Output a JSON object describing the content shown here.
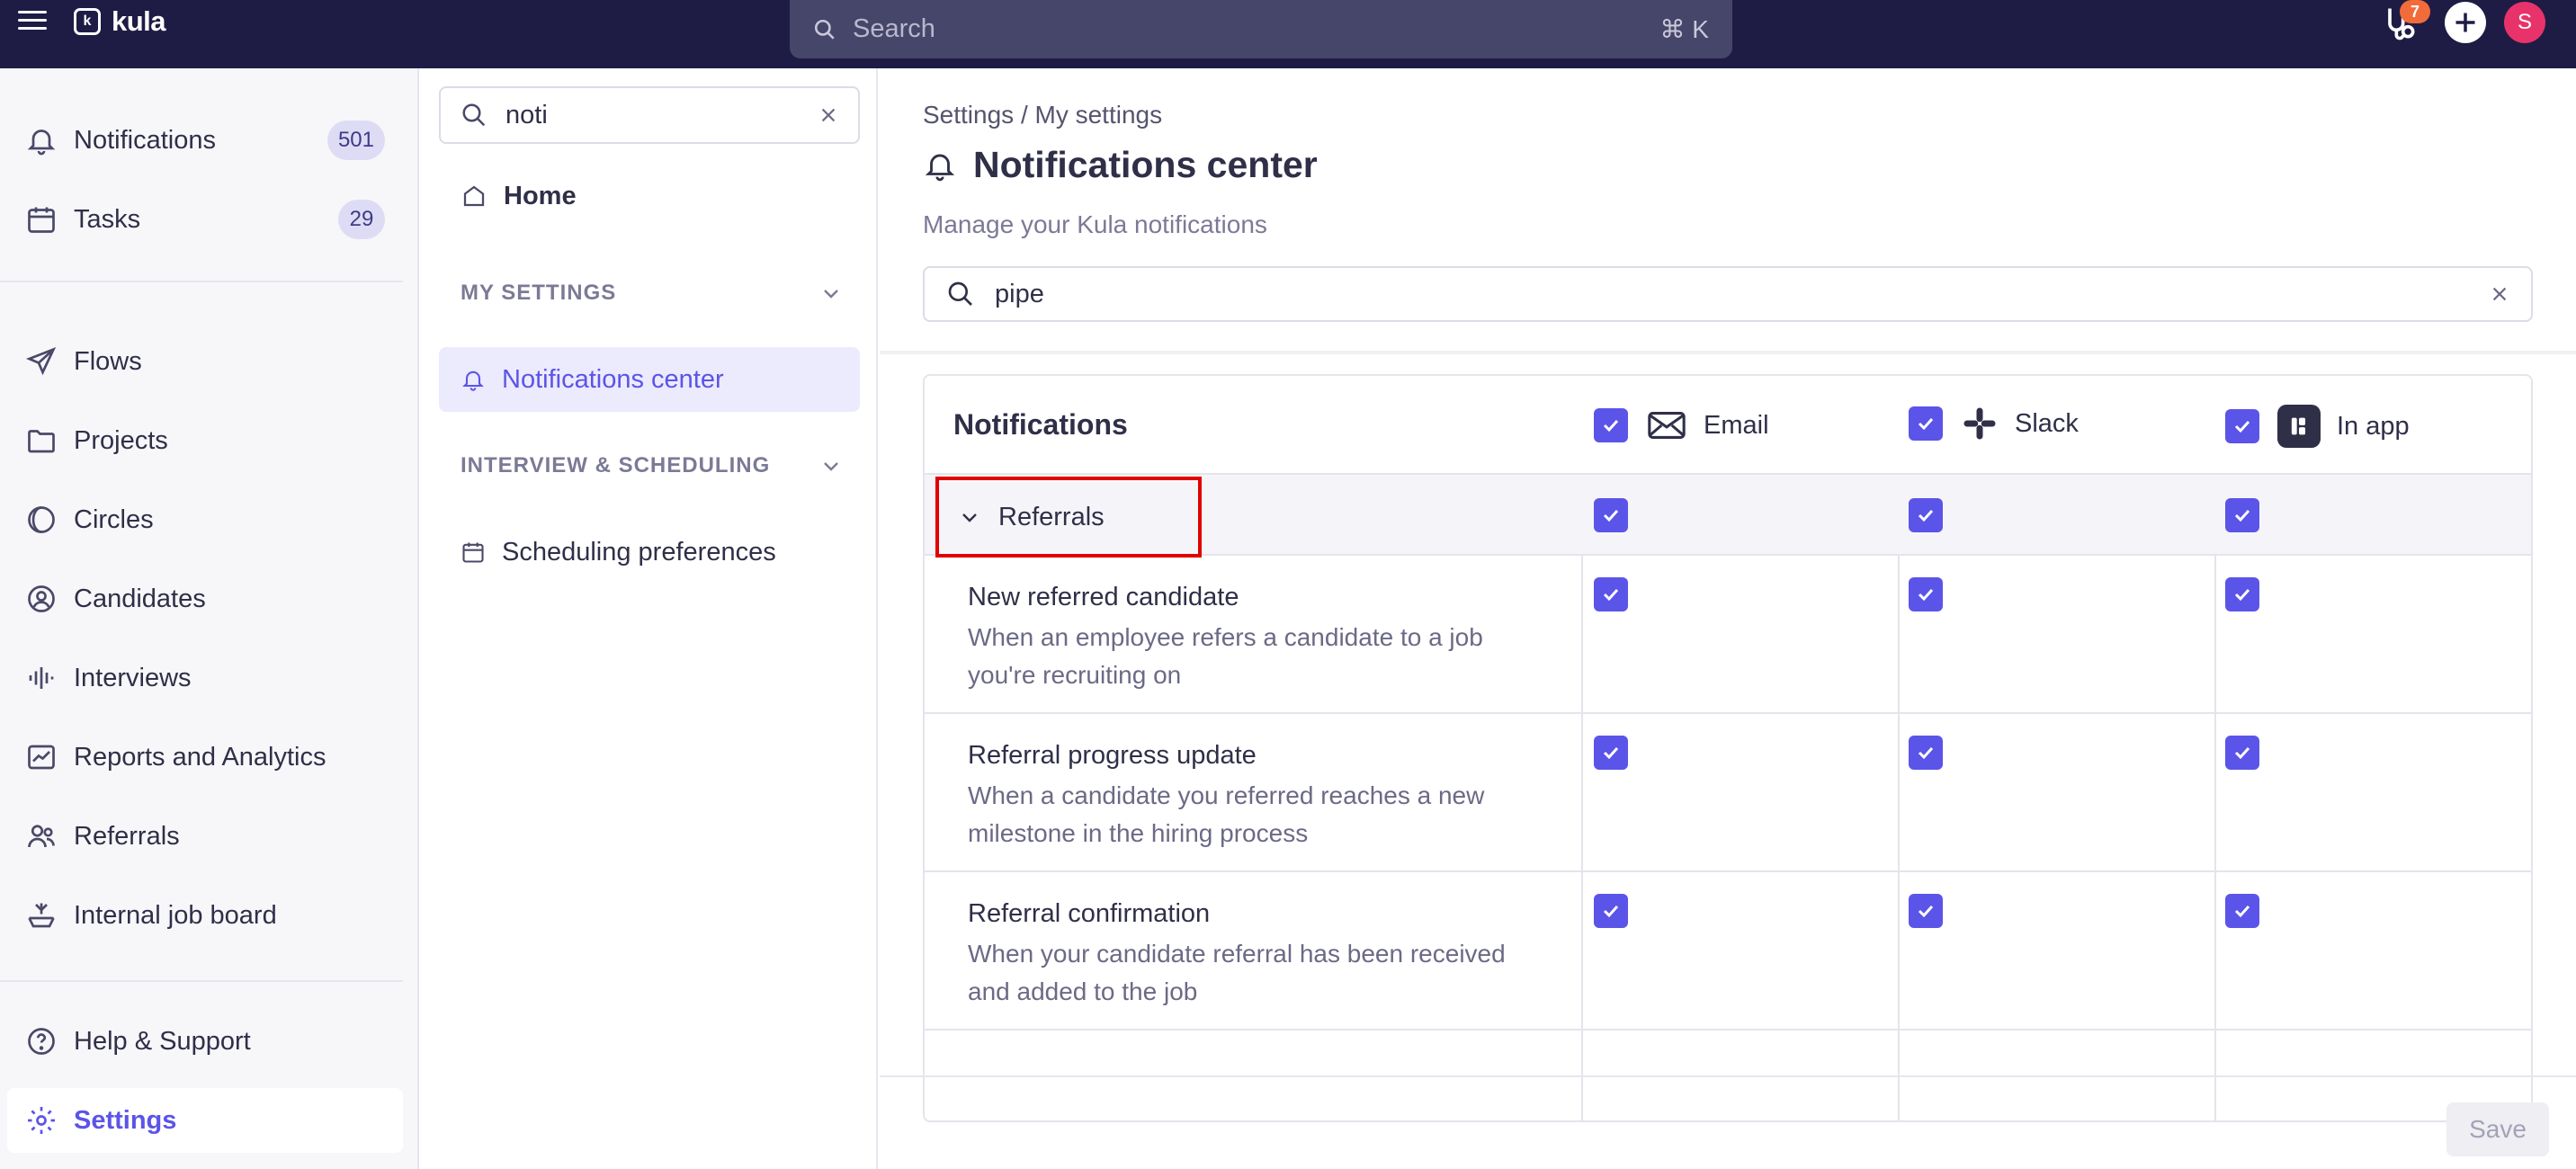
{
  "topbar": {
    "brand": "kula",
    "search_placeholder": "Search",
    "search_shortcut": "⌘ K",
    "notification_badge": "7",
    "avatar_initial": "S"
  },
  "sidebar": {
    "items": [
      {
        "label": "Notifications",
        "count": "501",
        "icon": "bell-icon"
      },
      {
        "label": "Tasks",
        "count": "29",
        "icon": "calendar-check-icon"
      },
      {
        "label": "Flows",
        "icon": "send-icon"
      },
      {
        "label": "Projects",
        "icon": "folder-icon"
      },
      {
        "label": "Circles",
        "icon": "circles-icon"
      },
      {
        "label": "Candidates",
        "icon": "user-circle-icon"
      },
      {
        "label": "Interviews",
        "icon": "audio-wave-icon"
      },
      {
        "label": "Reports and Analytics",
        "icon": "chart-icon"
      },
      {
        "label": "Referrals",
        "icon": "users-icon"
      },
      {
        "label": "Internal job board",
        "icon": "tray-icon"
      },
      {
        "label": "Help & Support",
        "icon": "help-icon"
      },
      {
        "label": "Settings",
        "icon": "gear-icon"
      }
    ]
  },
  "subpanel": {
    "search_value": "noti",
    "home_label": "Home",
    "my_settings_header": "MY SETTINGS",
    "notifications_center_label": "Notifications center",
    "interview_header": "INTERVIEW & SCHEDULING",
    "scheduling_label": "Scheduling preferences"
  },
  "main": {
    "breadcrumb": "Settings / My settings",
    "title": "Notifications center",
    "subtitle": "Manage your Kula notifications",
    "search_value": "pipe",
    "table": {
      "title": "Notifications",
      "columns": [
        "Email",
        "Slack",
        "In app"
      ],
      "group": "Referrals",
      "rows": [
        {
          "name": "New referred candidate",
          "desc": "When an employee refers a candidate to a job you're recruiting on"
        },
        {
          "name": "Referral progress update",
          "desc": "When a candidate you referred reaches a new milestone in the hiring process"
        },
        {
          "name": "Referral confirmation",
          "desc": "When your candidate referral has been received and added to the job"
        }
      ]
    },
    "save_label": "Save"
  },
  "colors": {
    "topbar": "#1e1c45",
    "accent": "#5b54e8",
    "highlight_box": "#e10000"
  }
}
